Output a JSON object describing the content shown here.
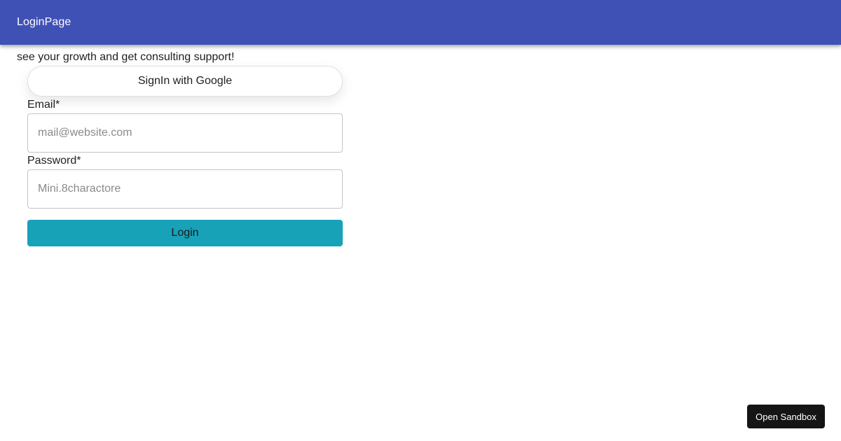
{
  "appbar": {
    "title": "LoginPage",
    "color": "#3f51b5"
  },
  "tagline": "see your growth and get consulting support!",
  "google_signin": {
    "label": "SignIn with Google"
  },
  "form": {
    "email": {
      "label": "Email*",
      "placeholder": "mail@website.com",
      "value": ""
    },
    "password": {
      "label": "Password*",
      "placeholder": "Mini.8charactore",
      "value": ""
    },
    "login_label": "Login",
    "login_color": "#17a2b8"
  },
  "sandbox": {
    "label": "Open Sandbox"
  }
}
